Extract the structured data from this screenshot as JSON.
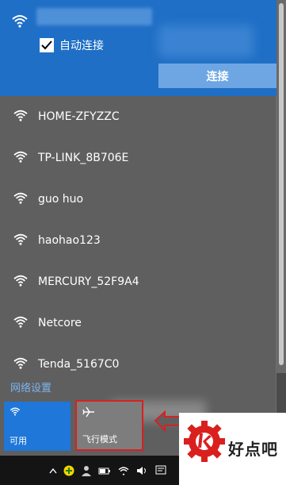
{
  "current_network": {
    "auto_connect_label": "自动连接",
    "auto_connect_checked": true,
    "connect_button": "连接"
  },
  "networks": [
    {
      "name": "HOME-ZFYZZC"
    },
    {
      "name": "TP-LINK_8B706E"
    },
    {
      "name": "guo huo"
    },
    {
      "name": "haohao123"
    },
    {
      "name": "MERCURY_52F9A4"
    },
    {
      "name": "Netcore"
    },
    {
      "name": "Tenda_5167C0"
    }
  ],
  "settings_link": "网络设置",
  "quick_actions": {
    "wifi_label": "可用",
    "airplane_label": "飞行模式"
  },
  "watermark": {
    "text": "好点吧"
  },
  "colors": {
    "accent": "#1f6fc6",
    "highlight": "#d9201f"
  }
}
